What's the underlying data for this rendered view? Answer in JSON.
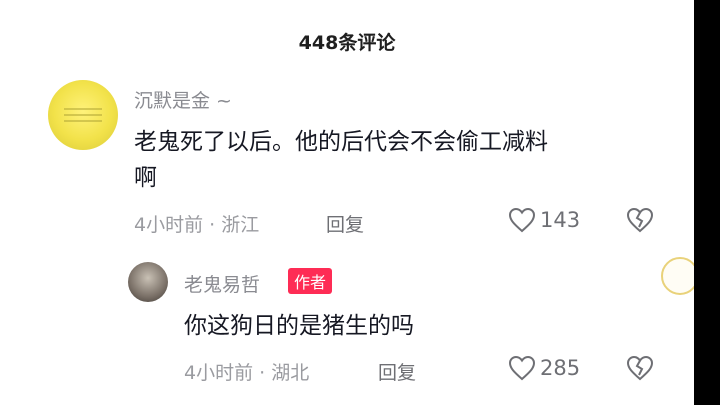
{
  "header": {
    "title": "448条评论"
  },
  "comments": [
    {
      "username": "沉默是金 ~",
      "text_line1": "老鬼死了以后。他的后代会不会偷工减料",
      "text_line2": "啊",
      "time": "4小时前 · 浙江",
      "reply_label": "回复",
      "likes": "143",
      "avatar_icon": "yellow-sign-avatar"
    }
  ],
  "reply": {
    "username": "老鬼易哲",
    "badge": "作者",
    "text": "你这狗日的是猪生的吗",
    "time": "4小时前 · 湖北",
    "reply_label": "回复",
    "likes": "285"
  },
  "colors": {
    "badge_bg": "#fe2c55",
    "meta_text": "#9a9ba0",
    "body_text": "#161823"
  }
}
